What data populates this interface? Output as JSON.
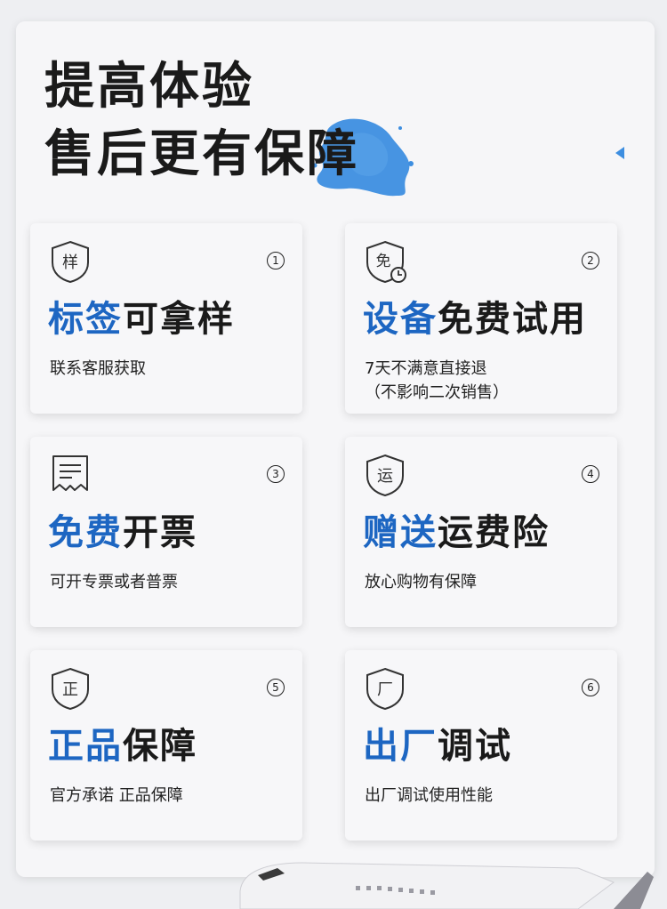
{
  "header": {
    "line1": "提高体验",
    "line2": "售后更有保障"
  },
  "cards": [
    {
      "num": "1",
      "icon_char": "样",
      "icon": "shield-icon",
      "title_highlight": "标签",
      "title_rest": "可拿样",
      "desc": "联系客服获取"
    },
    {
      "num": "2",
      "icon_char": "免",
      "icon": "shield-clock-icon",
      "title_highlight": "设备",
      "title_rest": "免费试用",
      "desc": "7天不满意直接退\n（不影响二次销售）"
    },
    {
      "num": "3",
      "icon_char": "",
      "icon": "receipt-icon",
      "title_highlight": "免费",
      "title_rest": "开票",
      "desc": "可开专票或者普票"
    },
    {
      "num": "4",
      "icon_char": "运",
      "icon": "shield-icon",
      "title_highlight": "赠送",
      "title_rest": "运费险",
      "desc": "放心购物有保障"
    },
    {
      "num": "5",
      "icon_char": "正",
      "icon": "shield-icon",
      "title_highlight": "正品",
      "title_rest": "保障",
      "desc": "官方承诺 正品保障"
    },
    {
      "num": "6",
      "icon_char": "厂",
      "icon": "shield-icon",
      "title_highlight": "出厂",
      "title_rest": "调试",
      "desc": "出厂调试使用性能"
    }
  ],
  "colors": {
    "accent": "#1d66c2",
    "splash": "#3d8ee0",
    "text": "#1a1a1a",
    "card_bg": "#f7f7f9"
  }
}
